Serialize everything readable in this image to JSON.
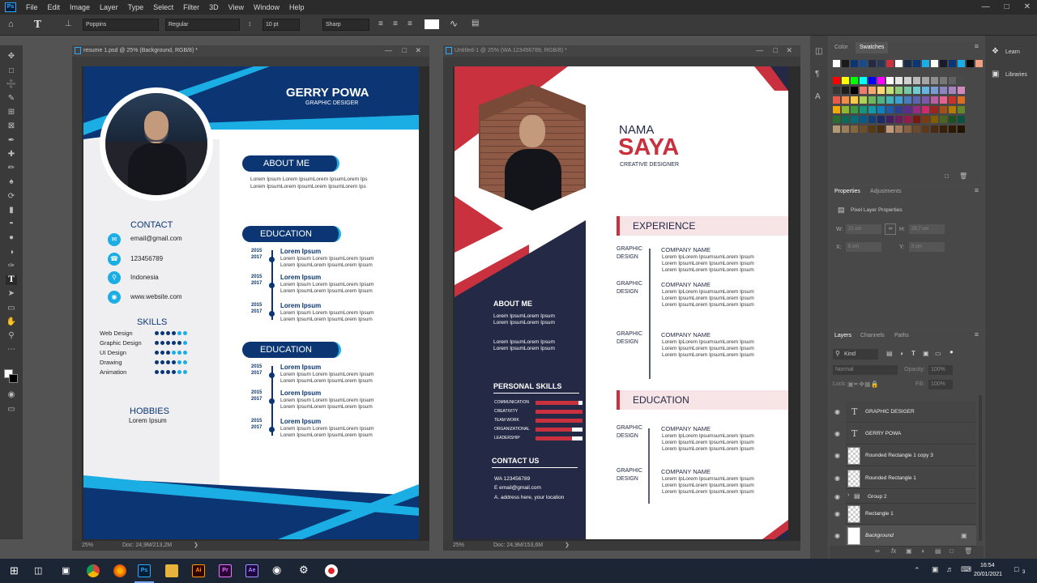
{
  "menubar": {
    "items": [
      "File",
      "Edit",
      "Image",
      "Layer",
      "Type",
      "Select",
      "Filter",
      "3D",
      "View",
      "Window",
      "Help"
    ],
    "ps_label": "Ps"
  },
  "options": {
    "font_family": "Poppins",
    "font_style": "Regular",
    "font_size": "10 pt",
    "antialias": "Sharp"
  },
  "doc1": {
    "title": "resume 1.psd @ 25% (Background, RGB/8) *",
    "zoom": "25%",
    "doc_size": "Doc: 24,9M/213,2M",
    "resume": {
      "name": "GERRY POWA",
      "role": "GRAPHIC DESIGER",
      "about_title": "ABOUT ME",
      "about_text_1": "Lorem Ipsum Lorem IpsumLorem IpsumLorem Ips",
      "about_text_2": "Lorem IpsumLorem IpsumLorem IpsumLorem Ips",
      "contact_title": "CONTACT",
      "email": "email@gmail.com",
      "phone": "123456789",
      "location": "Indonesia",
      "website": "www.website.com",
      "skills_title": "SKILLS",
      "skills": [
        "Web Design",
        "Graphic Design",
        "UI Design",
        "Drawing",
        "Animation"
      ],
      "hobbies_title": "HOBBIES",
      "hobbies_text": "Lorem Ipsum",
      "education_title": "EDUCATION",
      "edu_years": [
        "2015",
        "2017"
      ],
      "edu_item_title": "Lorem Ipsum",
      "edu_line_1": "Lorem Ipsum Lorem IpsumLorem Ipsum",
      "edu_line_2": "Lorem IpsumLorem IpsumLorem Ipsum"
    }
  },
  "doc2": {
    "title": "Untitled-1 @ 25% (WA 123456789, RGB/8) *",
    "zoom": "25%",
    "doc_size": "Doc: 24,9M/153,6M",
    "resume": {
      "nama": "NAMA",
      "saya": "SAYA",
      "role": "CREATIVE DESIGNER",
      "experience_title": "EXPERIENCE",
      "education_title": "EDUCATION",
      "job_left_1": "GRAPHIC",
      "job_left_2": "DESIGN",
      "company": "COMPANY NAME",
      "lorem_1": "Lorem IpLorem IpsumsumLorem Ipsum",
      "lorem_2": "Lorem IpsumLorem IpsumLorem Ipsum",
      "about_title": "ABOUT ME",
      "about_1": "Lorem IpsumLorem Ipsum",
      "about_2": "Lorem IpsumLorem Ipsum",
      "skills_title": "PERSONAL SKILLS",
      "skills": [
        {
          "name": "COMMUNICATION",
          "level": 0.92
        },
        {
          "name": "CREATIVITY",
          "level": 1.0
        },
        {
          "name": "TEAM WORK",
          "level": 1.0
        },
        {
          "name": "ORGANIZATIONAL",
          "level": 0.78
        },
        {
          "name": "LEADERSHIP",
          "level": 0.78
        }
      ],
      "contact_title": "CONTACT US",
      "contact_1": "WA 123456789",
      "contact_2": "E email@gmail.com",
      "contact_3": "A. address here, your location"
    }
  },
  "panels": {
    "color_tab": "Color",
    "swatches_tab": "Swatches",
    "learn": "Learn",
    "libraries": "Libraries",
    "properties_tab": "Properties",
    "adjustments_tab": "Adjustments",
    "pixel_layer": "Pixel Layer Properties",
    "w_label": "W:",
    "h_label": "H:",
    "x_label": "X:",
    "y_label": "Y:",
    "w_value": "21 cm",
    "h_value": "29,7 cm",
    "x_value": "0 cm",
    "y_value": "0 cm",
    "layers_tab": "Layers",
    "channels_tab": "Channels",
    "paths_tab": "Paths",
    "kind": "Kind",
    "blend": "Normal",
    "opacity_label": "Opacity:",
    "opacity": "100%",
    "lock_label": "Lock:",
    "fill_label": "Fill:",
    "fill": "100%",
    "layers": [
      "GRAPHIC DESIGER",
      "GERRY POWA",
      "Rounded Rectangle 1 copy 3",
      "Rounded Rectangle 1",
      "Group 2",
      "Rectangle 1",
      "Background"
    ]
  },
  "taskbar": {
    "time": "16:54",
    "date": "20/01/2021",
    "notif": "3"
  },
  "colors": {
    "navy": "#0b3673",
    "cyan": "#1aaee5",
    "red": "#c8313d",
    "dark_navy": "#242a45"
  }
}
